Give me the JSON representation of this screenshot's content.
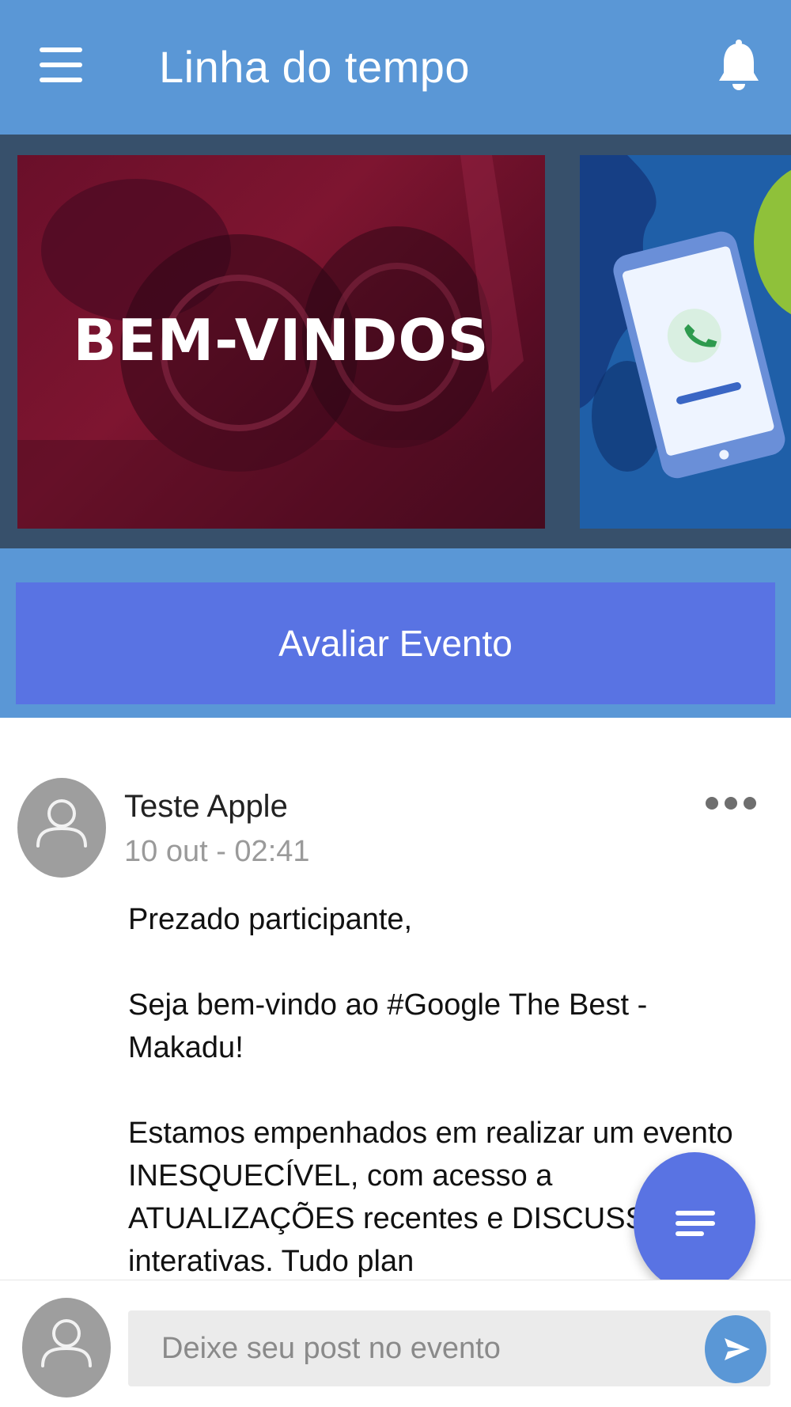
{
  "header": {
    "title": "Linha do tempo",
    "menu_icon": "hamburger-menu-icon",
    "notification_icon": "bell-icon"
  },
  "banners": [
    {
      "text": "BEM-VINDOS"
    },
    {
      "icon": "phone-call-icon"
    }
  ],
  "rate_event": {
    "label": "Avaliar Evento"
  },
  "post": {
    "author": "Teste Apple",
    "timestamp": "10 out - 02:41",
    "more_icon": "more-horizontal-icon",
    "avatar_icon": "person-icon",
    "paragraphs": [
      "Prezado participante,",
      "Seja bem-vindo ao #Google The Best - Makadu!",
      "Estamos empenhados em realizar um evento INESQUECÍVEL, com acesso a ATUALIZAÇÕES recentes e DISCUSSÕES interativas. Tudo plan"
    ]
  },
  "fab": {
    "icon": "filter-lines-icon"
  },
  "composer": {
    "placeholder": "Deixe seu post no evento",
    "avatar_icon": "person-icon",
    "send_icon": "send-icon"
  },
  "colors": {
    "app_bar": "#5a97d6",
    "accent": "#5973e3",
    "carousel_bg": "#37506b",
    "banner_red": "#7e1530",
    "banner_blue": "#163f85"
  }
}
